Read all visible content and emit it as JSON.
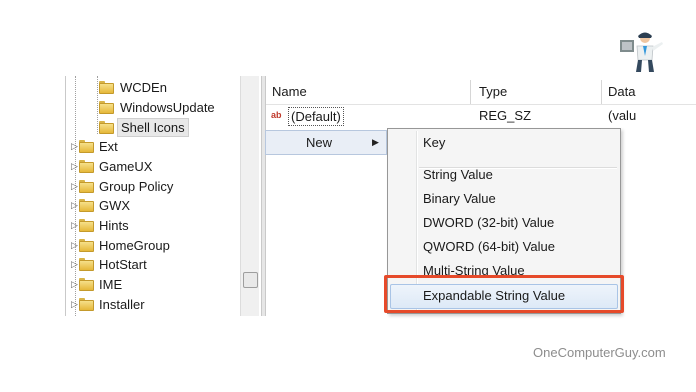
{
  "tree": {
    "items": [
      {
        "label": "WCDEn",
        "expander": "",
        "level": 2
      },
      {
        "label": "WindowsUpdate",
        "expander": "",
        "level": 2
      },
      {
        "label": "Shell Icons",
        "expander": "",
        "level": 2,
        "selected": true
      },
      {
        "label": "Ext",
        "expander": "▷",
        "level": 1
      },
      {
        "label": "GameUX",
        "expander": "▷",
        "level": 1
      },
      {
        "label": "Group Policy",
        "expander": "▷",
        "level": 1
      },
      {
        "label": "GWX",
        "expander": "▷",
        "level": 1
      },
      {
        "label": "Hints",
        "expander": "▷",
        "level": 1
      },
      {
        "label": "HomeGroup",
        "expander": "▷",
        "level": 1
      },
      {
        "label": "HotStart",
        "expander": "▷",
        "level": 1
      },
      {
        "label": "IME",
        "expander": "▷",
        "level": 1
      },
      {
        "label": "Installer",
        "expander": "▷",
        "level": 1
      }
    ]
  },
  "values_list": {
    "columns": [
      "Name",
      "Type",
      "Data"
    ],
    "rows": [
      {
        "icon": "ab",
        "name": "(Default)",
        "type": "REG_SZ",
        "data": "(valu"
      }
    ]
  },
  "context_menu": {
    "new_label": "New",
    "arrow": "▶"
  },
  "submenu": {
    "items": [
      {
        "label": "Key"
      },
      {
        "label": "String Value"
      },
      {
        "label": "Binary Value"
      },
      {
        "label": "DWORD (32-bit) Value"
      },
      {
        "label": "QWORD (64-bit) Value"
      },
      {
        "label": "Multi-String Value"
      },
      {
        "label": "Expandable String Value",
        "highlighted": true
      }
    ]
  },
  "highlight_color": "#e64a2a",
  "watermark": "OneComputerGuy.com"
}
